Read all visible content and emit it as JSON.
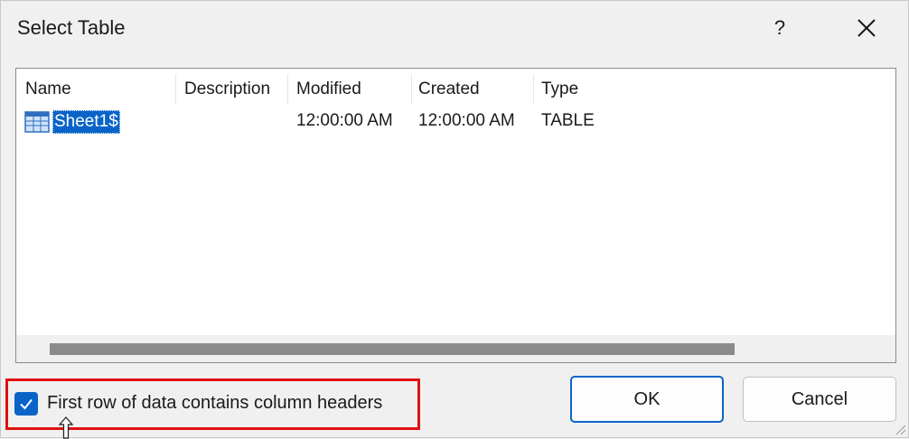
{
  "dialog": {
    "title": "Select Table",
    "help_label": "?",
    "close_icon": "close-icon"
  },
  "table": {
    "columns": [
      "Name",
      "Description",
      "Modified",
      "Created",
      "Type"
    ],
    "rows": [
      {
        "name": "Sheet1$",
        "description": "",
        "modified": "12:00:00 AM",
        "created": "12:00:00 AM",
        "type": "TABLE",
        "icon": "table-icon",
        "selected": true
      }
    ]
  },
  "options": {
    "first_row_headers_label": "First row of data contains column headers",
    "first_row_headers_checked": true
  },
  "buttons": {
    "ok_label": "OK",
    "cancel_label": "Cancel"
  },
  "colors": {
    "accent": "#0a64c8",
    "highlight": "#e01010"
  }
}
